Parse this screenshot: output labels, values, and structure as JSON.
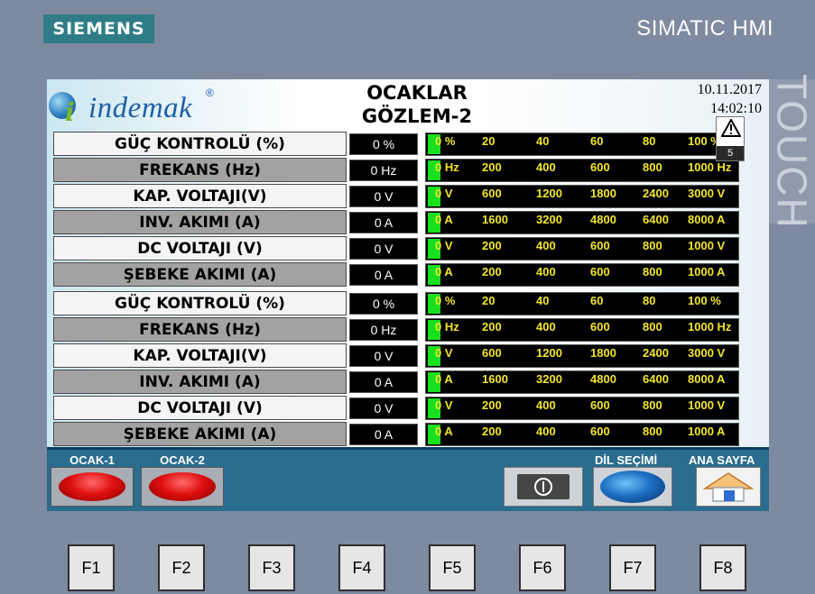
{
  "device": {
    "brand": "SIEMENS",
    "title": "SIMATIC HMI",
    "side_label": "TOUCH"
  },
  "header": {
    "logo_text": "indemak",
    "logo_i": "i",
    "logo_reg": "®",
    "title_line1": "OCAKLAR",
    "title_line2": "GÖZLEM-2",
    "date": "10.11.2017",
    "time": "14:02:10",
    "alarm_count": "5"
  },
  "groups": [
    {
      "rows": [
        {
          "label": "GÜÇ KONTROLÜ (%)",
          "value": "0 %",
          "fill": 0,
          "ticks": [
            "0 %",
            "20",
            "40",
            "60",
            "80",
            "100 %"
          ]
        },
        {
          "label": "FREKANS (Hz)",
          "value": "0 Hz",
          "fill": 0,
          "ticks": [
            "0 Hz",
            "200",
            "400",
            "600",
            "800",
            "1000 Hz"
          ]
        },
        {
          "label": "KAP. VOLTAJI(V)",
          "value": "0 V",
          "fill": 0,
          "ticks": [
            "0 V",
            "600",
            "1200",
            "1800",
            "2400",
            "3000 V"
          ]
        },
        {
          "label": "INV. AKIMI (A)",
          "value": "0 A",
          "fill": 0,
          "ticks": [
            "0 A",
            "1600",
            "3200",
            "4800",
            "6400",
            "8000 A"
          ]
        },
        {
          "label": "DC VOLTAJI (V)",
          "value": "0 V",
          "fill": 0,
          "ticks": [
            "0 V",
            "200",
            "400",
            "600",
            "800",
            "1000 V"
          ]
        },
        {
          "label": "ŞEBEKE AKIMI (A)",
          "value": "0 A",
          "fill": 0,
          "ticks": [
            "0 A",
            "200",
            "400",
            "600",
            "800",
            "1000 A"
          ]
        }
      ]
    },
    {
      "rows": [
        {
          "label": "GÜÇ KONTROLÜ (%)",
          "value": "0 %",
          "fill": 0,
          "ticks": [
            "0 %",
            "20",
            "40",
            "60",
            "80",
            "100 %"
          ]
        },
        {
          "label": "FREKANS (Hz)",
          "value": "0 Hz",
          "fill": 0,
          "ticks": [
            "0 Hz",
            "200",
            "400",
            "600",
            "800",
            "1000 Hz"
          ]
        },
        {
          "label": "KAP. VOLTAJI(V)",
          "value": "0 V",
          "fill": 0,
          "ticks": [
            "0 V",
            "600",
            "1200",
            "1800",
            "2400",
            "3000 V"
          ]
        },
        {
          "label": "INV. AKIMI (A)",
          "value": "0 A",
          "fill": 0,
          "ticks": [
            "0 A",
            "1600",
            "3200",
            "4800",
            "6400",
            "8000 A"
          ]
        },
        {
          "label": "DC VOLTAJI (V)",
          "value": "0 V",
          "fill": 0,
          "ticks": [
            "0 V",
            "200",
            "400",
            "600",
            "800",
            "1000 V"
          ]
        },
        {
          "label": "ŞEBEKE AKIMI (A)",
          "value": "0 A",
          "fill": 0,
          "ticks": [
            "0 A",
            "200",
            "400",
            "600",
            "800",
            "1000 A"
          ]
        }
      ]
    }
  ],
  "bottom": {
    "ocak1_label": "OCAK-1",
    "ocak2_label": "OCAK-2",
    "language_label": "DİL SEÇİMİ",
    "home_label": "ANA SAYFA",
    "ocak_lamp_color": "#e01010"
  },
  "function_keys": [
    "F1",
    "F2",
    "F3",
    "F4",
    "F5",
    "F6",
    "F7",
    "F8"
  ],
  "colors": {
    "bar_fill": "#19e01e",
    "tick_text": "#f2e62b",
    "bottom_panel": "#2a6d8e",
    "frame": "#7d8aa0"
  }
}
